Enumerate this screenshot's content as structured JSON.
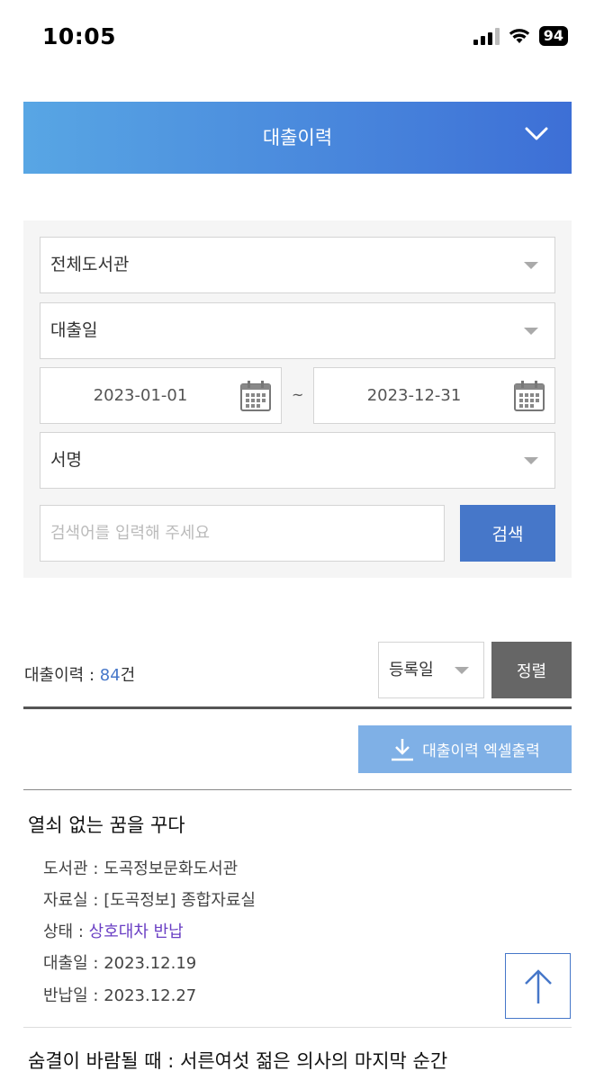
{
  "status_bar": {
    "time": "10:05",
    "battery": "94"
  },
  "header": {
    "title": "대출이력"
  },
  "search": {
    "library_select": "전체도서관",
    "date_type_select": "대출일",
    "start_date": "2023-01-01",
    "date_separator": "~",
    "end_date": "2023-12-31",
    "field_select": "서명",
    "placeholder": "검색어를 입력해 주세요",
    "button_label": "검색"
  },
  "results": {
    "count_label": "대출이력 : ",
    "count": "84",
    "count_unit": "건",
    "sort_select": "등록일",
    "sort_button": "정렬",
    "excel_button": "대출이력 엑셀출력"
  },
  "items": [
    {
      "title": "열쇠 없는 꿈을 꾸다",
      "library_label": "도서관 : ",
      "library": "도곡정보문화도서관",
      "room_label": "자료실 : ",
      "room": "[도곡정보] 종합자료실",
      "status_label": "상태 : ",
      "status": "상호대차 반납",
      "loan_date_label": "대출일 : ",
      "loan_date": "2023.12.19",
      "return_date_label": "반납일 : ",
      "return_date": "2023.12.27"
    },
    {
      "title": "숨결이 바람될 때 : 서른여섯 젊은 의사의 마지막 순간"
    }
  ],
  "colors": {
    "accent": "#4677c9",
    "status": "#6a3fc4",
    "excel": "#7fb0e6"
  }
}
